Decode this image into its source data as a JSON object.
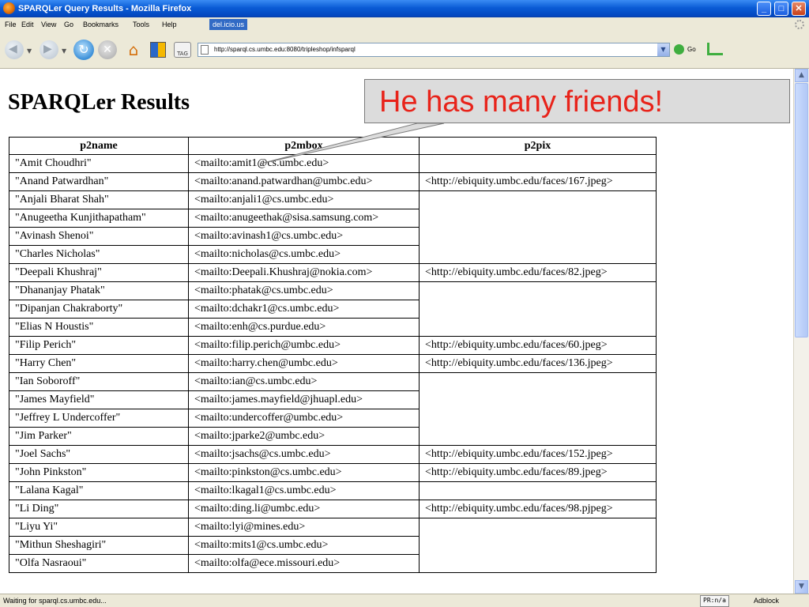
{
  "window": {
    "title": "SPARQLer Query Results - Mozilla Firefox",
    "controls": {
      "minimize": "_",
      "maximize": "□",
      "close": "✕"
    }
  },
  "menu": {
    "items": [
      "File",
      "Edit",
      "View",
      "Go",
      "Bookmarks",
      "Tools",
      "Help"
    ],
    "delicious": "del.icio.us"
  },
  "toolbar": {
    "url": "http://sparql.cs.umbc.edu:8080/tripleshop/infsparql",
    "go_label": "Go",
    "tag_label": "TAG"
  },
  "page": {
    "title": "SPARQLer Results",
    "callout": "He has many friends!"
  },
  "table": {
    "headers": [
      "p2name",
      "p2mbox",
      "p2pix"
    ],
    "rows": [
      [
        "\"Amit Choudhri\"",
        "<mailto:amit1@cs.umbc.edu>",
        ""
      ],
      [
        "\"Anand Patwardhan\"",
        "<mailto:anand.patwardhan@umbc.edu>",
        "<http://ebiquity.umbc.edu/faces/167.jpeg>"
      ],
      [
        "\"Anjali Bharat Shah\"",
        "<mailto:anjali1@cs.umbc.edu>",
        ""
      ],
      [
        "\"Anugeetha Kunjithapatham\"",
        "<mailto:anugeethak@sisa.samsung.com>",
        ""
      ],
      [
        "\"Avinash Shenoi\"",
        "<mailto:avinash1@cs.umbc.edu>",
        ""
      ],
      [
        "\"Charles Nicholas\"",
        "<mailto:nicholas@cs.umbc.edu>",
        ""
      ],
      [
        "\"Deepali Khushraj\"",
        "<mailto:Deepali.Khushraj@nokia.com>",
        "<http://ebiquity.umbc.edu/faces/82.jpeg>"
      ],
      [
        "\"Dhananjay Phatak\"",
        "<mailto:phatak@cs.umbc.edu>",
        ""
      ],
      [
        "\"Dipanjan Chakraborty\"",
        "<mailto:dchakr1@cs.umbc.edu>",
        ""
      ],
      [
        "\"Elias N Houstis\"",
        "<mailto:enh@cs.purdue.edu>",
        ""
      ],
      [
        "\"Filip Perich\"",
        "<mailto:filip.perich@umbc.edu>",
        "<http://ebiquity.umbc.edu/faces/60.jpeg>"
      ],
      [
        "\"Harry Chen\"",
        "<mailto:harry.chen@umbc.edu>",
        "<http://ebiquity.umbc.edu/faces/136.jpeg>"
      ],
      [
        "\"Ian Soboroff\"",
        "<mailto:ian@cs.umbc.edu>",
        ""
      ],
      [
        "\"James Mayfield\"",
        "<mailto:james.mayfield@jhuapl.edu>",
        ""
      ],
      [
        "\"Jeffrey L Undercoffer\"",
        "<mailto:undercoffer@umbc.edu>",
        ""
      ],
      [
        "\"Jim Parker\"",
        "<mailto:jparke2@umbc.edu>",
        ""
      ],
      [
        "\"Joel Sachs\"",
        "<mailto:jsachs@cs.umbc.edu>",
        "<http://ebiquity.umbc.edu/faces/152.jpeg>"
      ],
      [
        "\"John Pinkston\"",
        "<mailto:pinkston@cs.umbc.edu>",
        "<http://ebiquity.umbc.edu/faces/89.jpeg>"
      ],
      [
        "\"Lalana Kagal\"",
        "<mailto:lkagal1@cs.umbc.edu>",
        ""
      ],
      [
        "\"Li Ding\"",
        "<mailto:ding.li@umbc.edu>",
        "<http://ebiquity.umbc.edu/faces/98.pjpeg>"
      ],
      [
        "\"Liyu Yi\"",
        "<mailto:lyi@mines.edu>",
        ""
      ],
      [
        "\"Mithun Sheshagiri\"",
        "<mailto:mits1@cs.umbc.edu>",
        ""
      ],
      [
        "\"Olfa Nasraoui\"",
        "<mailto:olfa@ece.missouri.edu>",
        ""
      ]
    ]
  },
  "status": {
    "text": "Waiting for sparql.cs.umbc.edu...",
    "pagerank": "PR:n/a",
    "adblock": "Adblock"
  },
  "colors": {
    "callout_text": "#e8231a",
    "titlebar": "#0a5bd5"
  }
}
